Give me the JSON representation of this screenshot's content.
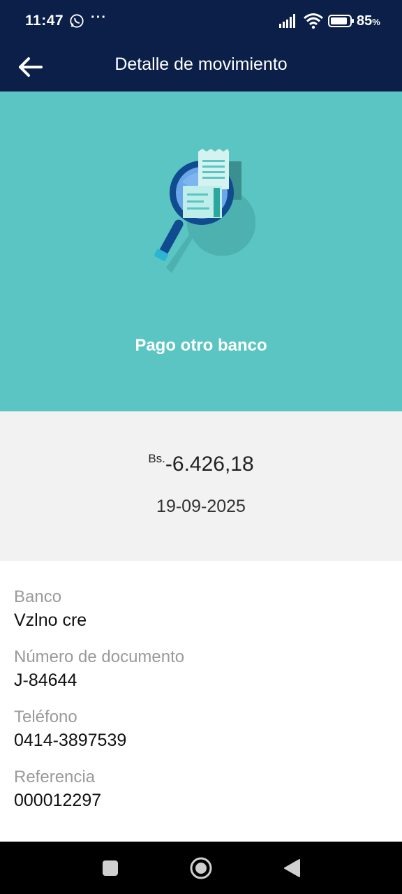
{
  "status_bar": {
    "time": "11:47",
    "more": "···",
    "battery_percent": "85",
    "battery_unit": "%",
    "icons": [
      "whatsapp-icon",
      "signal-icon",
      "wifi-icon",
      "battery-icon"
    ]
  },
  "app_bar": {
    "title": "Detalle de movimiento",
    "back_icon": "arrow-left-icon"
  },
  "hero": {
    "title": "Pago otro banco",
    "illustration": "magnifier-receipt-illustration",
    "background_color": "#5ac5c3"
  },
  "transaction": {
    "currency": "Bs.",
    "amount": "-6.426,18",
    "date": "19-09-2025"
  },
  "details": [
    {
      "label": "Banco",
      "value": "Vzlno cre"
    },
    {
      "label": "Número de documento",
      "value": "J-84644"
    },
    {
      "label": "Teléfono",
      "value": "0414-3897539"
    },
    {
      "label": "Referencia",
      "value": "000012297"
    }
  ],
  "nav_bar": {
    "buttons": [
      "recents-button",
      "home-button",
      "back-button"
    ]
  },
  "colors": {
    "primary_dark": "#0b1f48",
    "accent_teal": "#5ac5c3"
  }
}
